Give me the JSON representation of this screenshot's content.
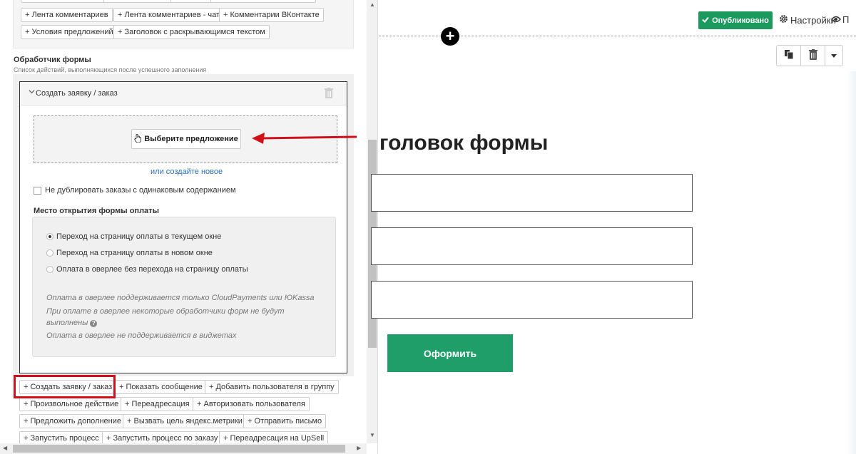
{
  "top_tags": {
    "row0": [
      "",
      "",
      "",
      ""
    ],
    "row1": [
      "+ Лента комментариев",
      "+ Лента комментариев - чат",
      "+ Комментарии ВКонтакте"
    ],
    "row2": [
      "+ Условия предложений",
      "+ Заголовок с раскрывающимся текстом"
    ]
  },
  "handler": {
    "title": "Обработчик формы",
    "subtitle": "Список действий, выполняющихся после успешного заполнения",
    "card_title": "Создать заявку / заказ",
    "choose_offer": "Выберите предложение",
    "create_new": "или создайте новое",
    "no_duplicates": "Не дублировать заказы с одинаковым содержанием",
    "payment_group_title": "Место открытия формы оплаты",
    "radio_options": [
      "Переход на страницу оплаты в текущем окне",
      "Переход на страницу оплаты в новом окне",
      "Оплата в оверлее без перехода на страницу оплаты"
    ],
    "selected_radio": 0,
    "notes": [
      "Оплата в оверлее поддерживается только CloudPayments или ЮKassa",
      "При оплате в оверлее некоторые обработчики форм не будут",
      "выполнены",
      "Оплата в оверлее не поддерживается в виджетах"
    ]
  },
  "action_buttons": {
    "row1": [
      "+ Создать заявку / заказ",
      "+ Показать сообщение",
      "+ Добавить пользователя в группу"
    ],
    "row2": [
      "+ Произвольное действие",
      "+ Переадресация",
      "+ Авторизовать пользователя"
    ],
    "row3": [
      "+ Предложить дополнение",
      "+ Вызвать цель яндекс.метрики",
      "+ Отправить письмо"
    ],
    "row4": [
      "+ Запустить процесс",
      "+ Запустить процесс по заказу",
      "+ Переадресация на UpSell"
    ]
  },
  "header": {
    "published_label": "Опубликовано",
    "settings_label": "Настройки",
    "preview_label": "П"
  },
  "form": {
    "heading": "головок формы",
    "submit_label": "Оформить"
  },
  "colors": {
    "published_green": "#1a9a5c",
    "submit_green": "#1f9e6a",
    "highlight_red": "#d0111b",
    "link_blue": "#2b6fb5"
  }
}
